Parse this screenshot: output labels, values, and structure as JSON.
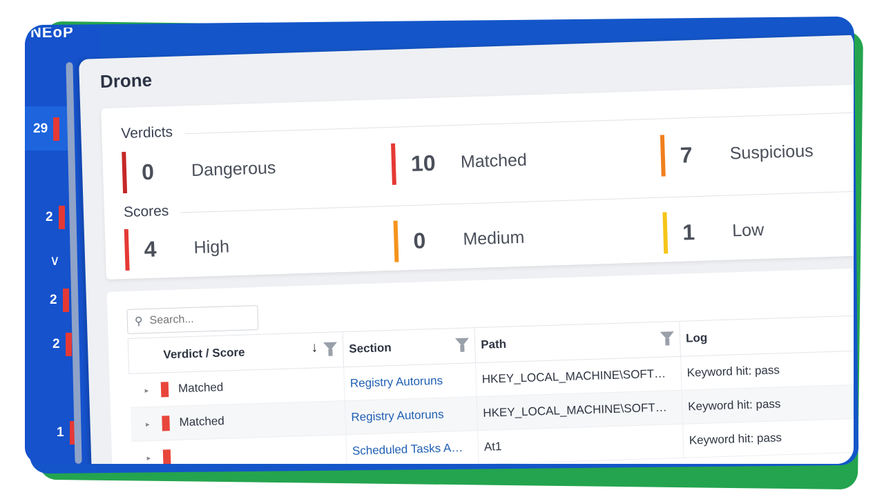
{
  "brand": "NEoP",
  "sidebar": {
    "items": [
      {
        "count": "29",
        "color": "#e53935"
      },
      {
        "count": "2",
        "color": "#e53935"
      },
      {
        "count": "2",
        "color": "#e53935"
      },
      {
        "count": "2",
        "color": "#e53935"
      },
      {
        "count": "1",
        "color": "#e53935"
      }
    ],
    "chevron": "chevron-down-icon"
  },
  "page": {
    "title": "Drone"
  },
  "verdicts": {
    "label": "Verdicts",
    "items": [
      {
        "value": "0",
        "label": "Dangerous",
        "color": "#c62828"
      },
      {
        "value": "10",
        "label": "Matched",
        "color": "#e53935"
      },
      {
        "value": "7",
        "label": "Suspicious",
        "color": "#f07f1e"
      }
    ]
  },
  "scores": {
    "label": "Scores",
    "items": [
      {
        "value": "4",
        "label": "High",
        "color": "#e53935"
      },
      {
        "value": "0",
        "label": "Medium",
        "color": "#f5941e"
      },
      {
        "value": "1",
        "label": "Low",
        "color": "#f5c518"
      }
    ]
  },
  "search": {
    "placeholder": "Search..."
  },
  "table": {
    "headers": [
      "Verdict / Score",
      "Section",
      "Path",
      "Log"
    ],
    "rows": [
      {
        "verdict": "Matched",
        "section": "Registry Autoruns",
        "path": "HKEY_LOCAL_MACHINE\\SOFT…",
        "log": "Keyword hit: pass"
      },
      {
        "verdict": "Matched",
        "section": "Registry Autoruns",
        "path": "HKEY_LOCAL_MACHINE\\SOFT…",
        "log": "Keyword hit: pass"
      },
      {
        "verdict": "",
        "section": "Scheduled Tasks A…",
        "path": "At1",
        "log": "Keyword hit: pass"
      }
    ]
  }
}
